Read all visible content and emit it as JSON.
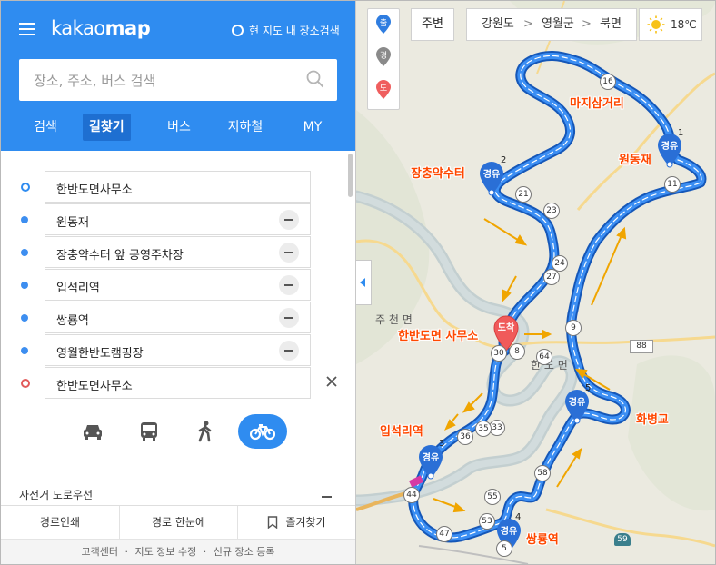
{
  "header": {
    "logo_light": "kakao",
    "logo_bold": "map",
    "nearby_search": "현 지도 내 장소검색",
    "search_placeholder": "장소, 주소, 버스 검색",
    "tabs": [
      {
        "label": "검색"
      },
      {
        "label": "길찾기",
        "active": true
      },
      {
        "label": "버스"
      },
      {
        "label": "지하철"
      },
      {
        "label": "MY"
      }
    ]
  },
  "route": {
    "points": [
      {
        "label": "한반도면사무소",
        "kind": "start"
      },
      {
        "label": "원동재",
        "kind": "via"
      },
      {
        "label": "장충약수터 앞 공영주차장",
        "kind": "via"
      },
      {
        "label": "입석리역",
        "kind": "via"
      },
      {
        "label": "쌍룡역",
        "kind": "via"
      },
      {
        "label": "영월한반도캠핑장",
        "kind": "via"
      },
      {
        "label": "한반도면사무소",
        "kind": "end"
      }
    ],
    "modes": [
      {
        "name": "car"
      },
      {
        "name": "bus"
      },
      {
        "name": "walk"
      },
      {
        "name": "bicycle",
        "active": true
      }
    ]
  },
  "section_title": "자전거 도로우선",
  "bottom_actions": {
    "print": "경로인쇄",
    "overview": "경로 한눈에",
    "favorite": "즐겨찾기"
  },
  "footer": {
    "links": [
      "고객센터",
      "지도 정보 수정",
      "신규 장소 등록"
    ],
    "separator": "·"
  },
  "map": {
    "pin_buttons": [
      {
        "label": "출",
        "color": "#2f7de0"
      },
      {
        "label": "경",
        "color": "#8a8a8a"
      },
      {
        "label": "도",
        "color": "#ef5e5e"
      }
    ],
    "nearby_button": "주변",
    "breadcrumb": [
      "강원도",
      "영월군",
      "북면"
    ],
    "breadcrumb_sep": ">",
    "temperature": "18℃",
    "arrival_label": "도착",
    "waypoint_marker_label": "경유",
    "place_labels": [
      "마지삼거리",
      "원동재",
      "장충약수터",
      "한반도면 사무소",
      "화병교",
      "입석리역",
      "쌍룡역"
    ],
    "town_label_1": "주 천 면",
    "town_label_2": "한  도 면",
    "road_numbers": [
      "88",
      "59"
    ],
    "route_numbers": [
      "16",
      "1",
      "2",
      "11",
      "21",
      "23",
      "24",
      "27",
      "9",
      "30",
      "8",
      "64",
      "5",
      "33",
      "35",
      "36",
      "3",
      "58",
      "44",
      "55",
      "53",
      "47",
      "4",
      "5"
    ],
    "waypoint_numbers": [
      "1",
      "2",
      "3",
      "4",
      "5"
    ],
    "colors": {
      "route": "#2a7de1",
      "accent": "#2f8cf0",
      "label": "#ff4800",
      "arrow": "#f0a500"
    }
  }
}
